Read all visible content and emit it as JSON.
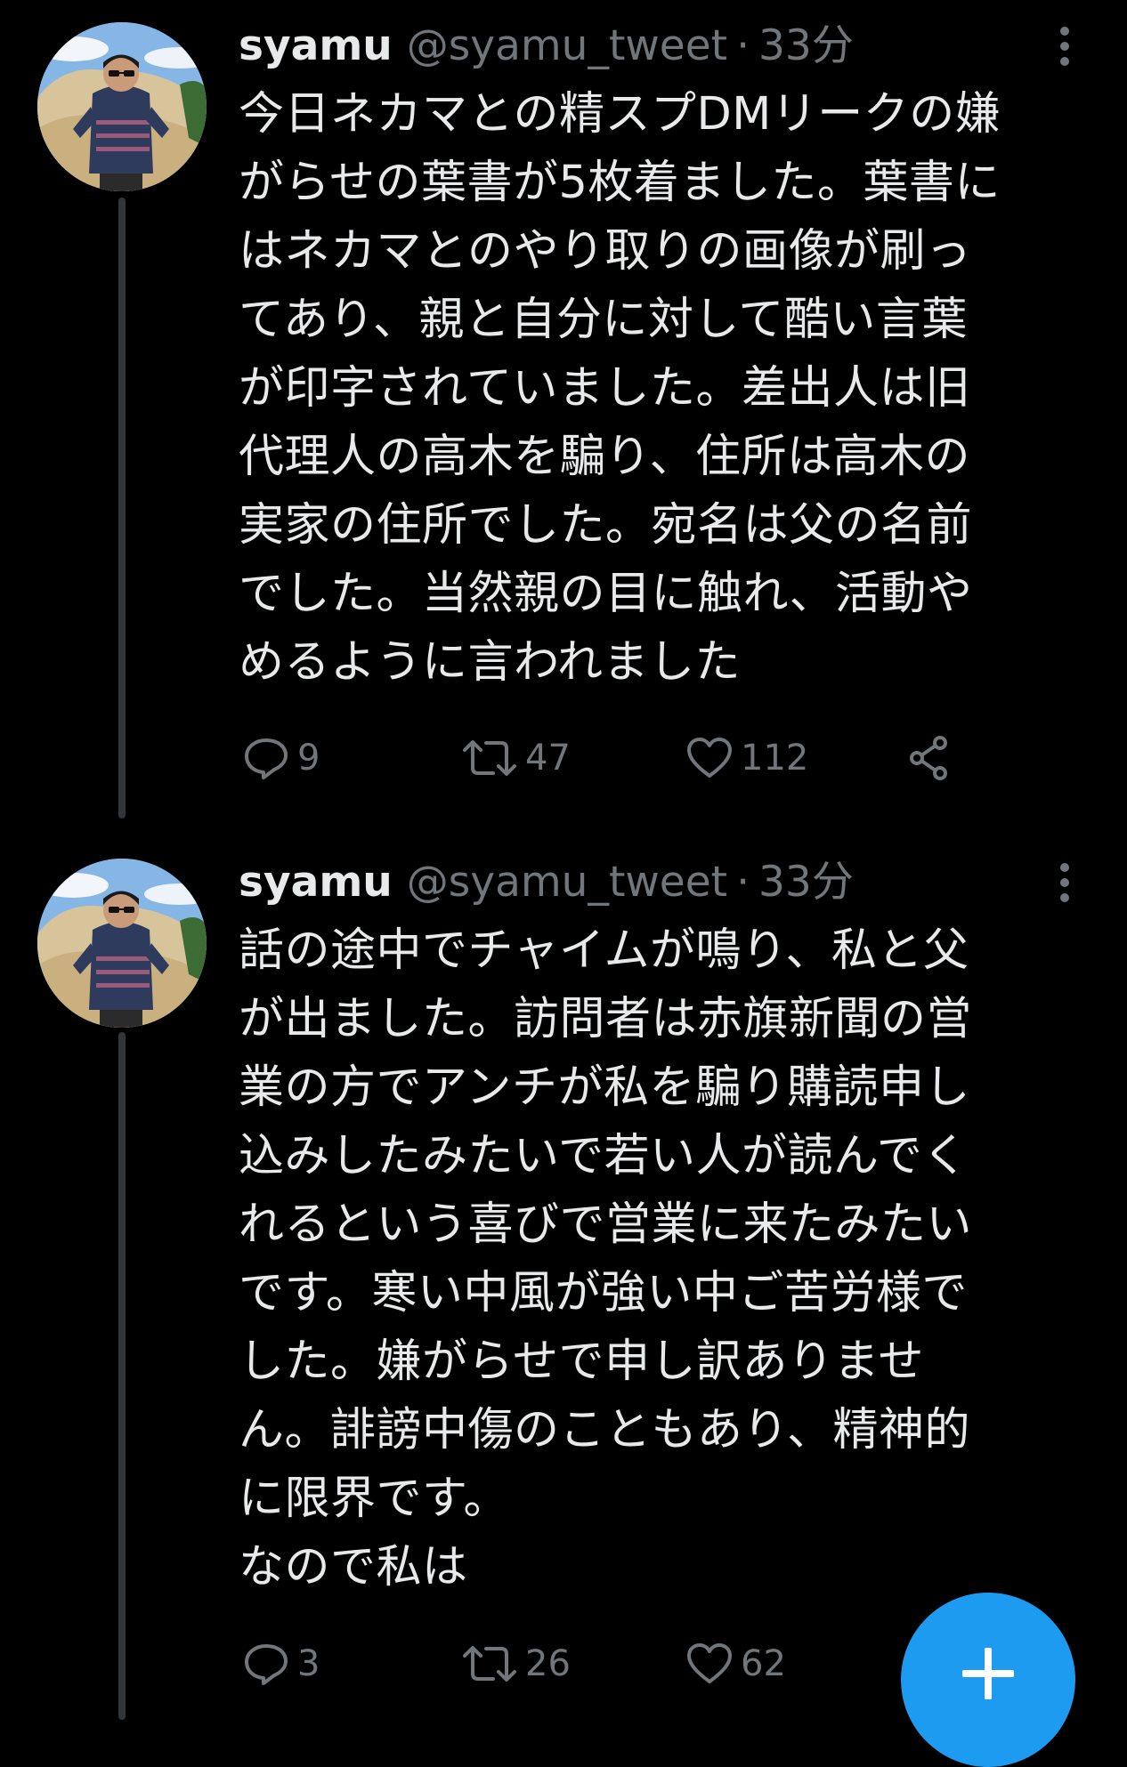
{
  "accent_color": "#1d9bf0",
  "tweets": [
    {
      "name": "syamu",
      "handle": "@syamu_tweet",
      "separator": "·",
      "time": "33分",
      "lines": [
        "今日ネカマとの精スプDMリークの嫌",
        "がらせの葉書が5枚着ました。葉書に",
        "はネカマとのやり取りの画像が刷っ",
        "てあり、親と自分に対して酷い言葉",
        "が印字されていました。差出人は旧",
        "代理人の高木を騙り、住所は高木の",
        "実家の住所でした。宛名は父の名前",
        "でした。当然親の目に触れ、活動や",
        "めるように言われました"
      ],
      "reply_count": "9",
      "retweet_count": "47",
      "like_count": "112"
    },
    {
      "name": "syamu",
      "handle": "@syamu_tweet",
      "separator": "·",
      "time": "33分",
      "lines": [
        "話の途中でチャイムが鳴り、私と父",
        "が出ました。訪問者は赤旗新聞の営",
        "業の方でアンチが私を騙り購読申し",
        "込みしたみたいで若い人が読んでく",
        "れるという喜びで営業に来たみたい",
        "です。寒い中風が強い中ご苦労様で",
        "した。嫌がらせで申し訳ありませ",
        "ん。誹謗中傷のこともあり、精神的",
        "に限界です。",
        "なので私は"
      ],
      "reply_count": "3",
      "retweet_count": "26",
      "like_count": "62"
    }
  ]
}
